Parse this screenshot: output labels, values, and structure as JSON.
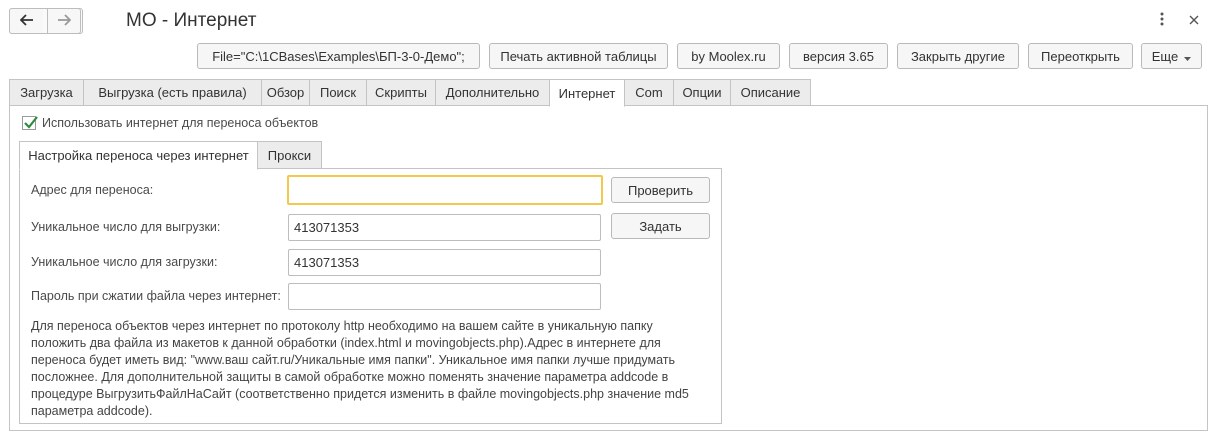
{
  "window": {
    "title": "МО - Интернет",
    "menu_icon": "more-vertical-icon",
    "close_icon": "close-icon",
    "back_icon": "arrow-left-icon",
    "forward_icon": "arrow-right-icon"
  },
  "toolbar": {
    "file_path": "File=\"C:\\1CBases\\Examples\\БП-3-0-Демо\";",
    "print_table": "Печать активной таблицы",
    "by_moolex": "by Moolex.ru",
    "version": "версия 3.65",
    "close_others": "Закрыть другие",
    "reopen": "Переоткрыть",
    "more": "Еще"
  },
  "tabs": [
    {
      "label": "Загрузка"
    },
    {
      "label": "Выгрузка (есть правила)"
    },
    {
      "label": "Обзор"
    },
    {
      "label": "Поиск"
    },
    {
      "label": "Скрипты"
    },
    {
      "label": "Дополнительно"
    },
    {
      "label": "Интернет"
    },
    {
      "label": "Com"
    },
    {
      "label": "Опции"
    },
    {
      "label": "Описание"
    }
  ],
  "active_tab": "Интернет",
  "use_internet": {
    "label": "Использовать интернет для переноса объектов",
    "checked": true
  },
  "subtabs": [
    {
      "label": "Настройка переноса через интернет"
    },
    {
      "label": "Прокси"
    }
  ],
  "form": {
    "address_label": "Адрес для переноса:",
    "address_value": "",
    "check_button": "Проверить",
    "upload_number_label": "Уникальное число для выгрузки:",
    "upload_number_value": "413071353",
    "set_button": "Задать",
    "download_number_label": "Уникальное число для загрузки:",
    "download_number_value": "413071353",
    "password_label": "Пароль при сжатии файла через интернет:",
    "password_value": ""
  },
  "description": "Для переноса объектов через интернет по протоколу http необходимо на вашем сайте в уникальную папку положить два файла из макетов к данной обработки (index.html и movingobjects.php).Адрес в интернете для переноса будет иметь вид: \"www.ваш сайт.ru/Уникальные имя папки\". Уникальное имя папки лучше придумать посложнее. Для дополнительной защиты в самой обработке можно поменять значение параметра addcode в процедуре ВыгрузитьФайлНаСайт (соответственно придется изменить в файле movingobjects.php значение md5 параметра addcode)."
}
